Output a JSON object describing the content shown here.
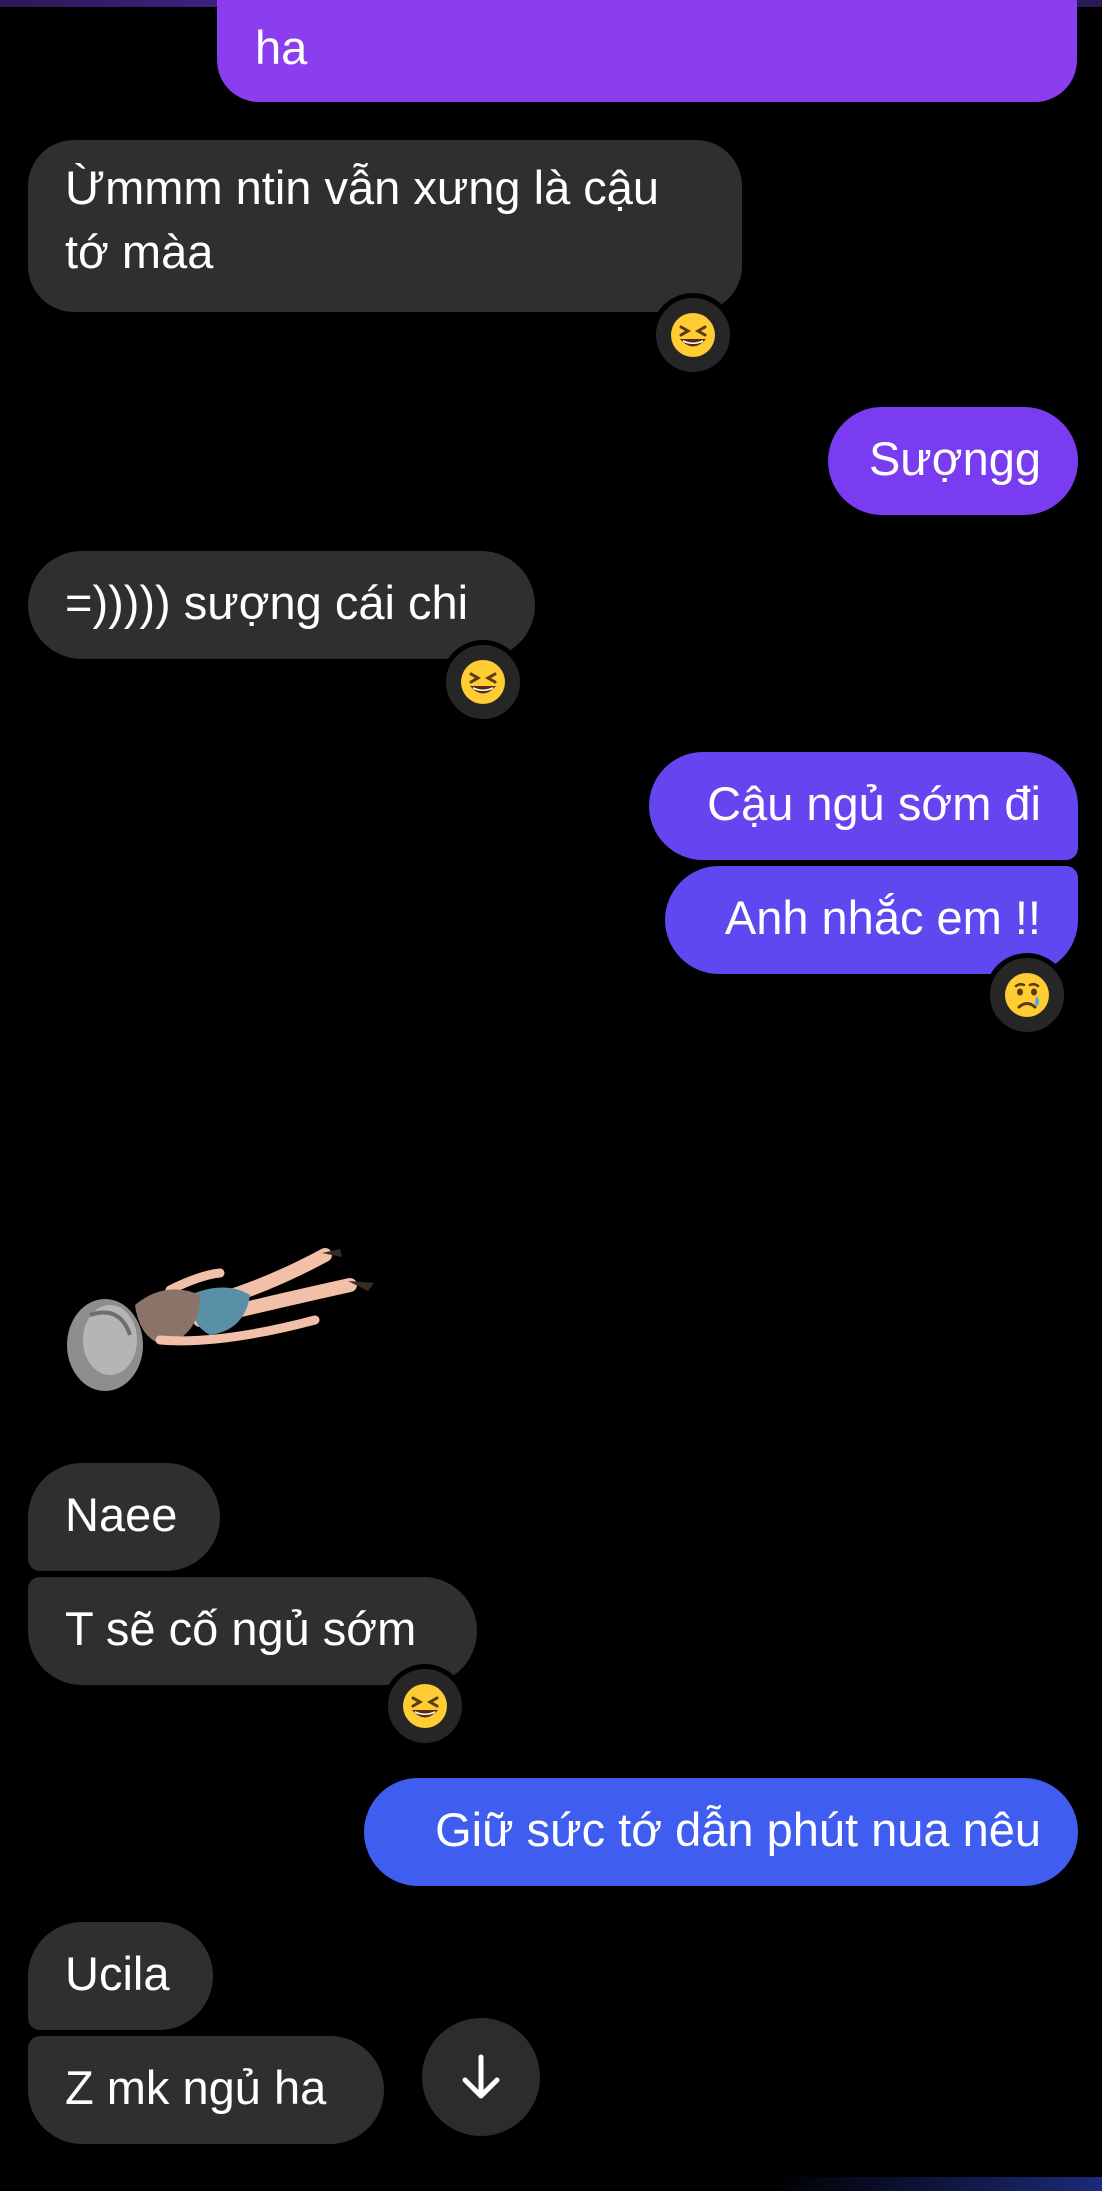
{
  "conversation": {
    "messages": [
      {
        "id": "m1",
        "direction": "outgoing",
        "lines": [
          "ha"
        ],
        "color": "#8a3ef0"
      },
      {
        "id": "m2",
        "direction": "incoming",
        "lines": [
          "Ừmmm ntin vẫn xưng là cậu",
          "tớ màa"
        ],
        "reaction": "grinning-squinting-face"
      },
      {
        "id": "m3",
        "direction": "outgoing",
        "lines": [
          "Sượngg"
        ],
        "color": "#7a3cf0"
      },
      {
        "id": "m4",
        "direction": "incoming",
        "lines": [
          "=))))) sượng cái chi"
        ],
        "reaction": "grinning-squinting-face"
      },
      {
        "id": "m5",
        "direction": "outgoing",
        "lines": [
          "Cậu ngủ sớm đi"
        ],
        "color": "#6645f0"
      },
      {
        "id": "m6",
        "direction": "outgoing",
        "lines": [
          "Anh nhắc em !!"
        ],
        "color": "#5e48f0",
        "reaction": "crying-face"
      },
      {
        "id": "m7",
        "direction": "incoming",
        "type": "sticker",
        "sticker": "lying-down-girl-sticker"
      },
      {
        "id": "m8",
        "direction": "incoming",
        "lines": [
          "Naee"
        ]
      },
      {
        "id": "m9",
        "direction": "incoming",
        "lines": [
          "T sẽ cố ngủ sớm"
        ],
        "reaction": "grinning-squinting-face"
      },
      {
        "id": "m10",
        "direction": "outgoing",
        "lines": [
          "Giữ sức tớ dẫn phút nua nêu"
        ],
        "color": "#3f5ef0"
      },
      {
        "id": "m11",
        "direction": "incoming",
        "lines": [
          "Ucila"
        ]
      },
      {
        "id": "m12",
        "direction": "incoming",
        "lines": [
          "Z mk ngủ ha"
        ]
      }
    ]
  },
  "controls": {
    "scroll_to_bottom_icon": "arrow-down-icon"
  },
  "theme": {
    "background": "#000000",
    "incoming_bubble": "#2f2f2f",
    "text": "#ffffff"
  }
}
